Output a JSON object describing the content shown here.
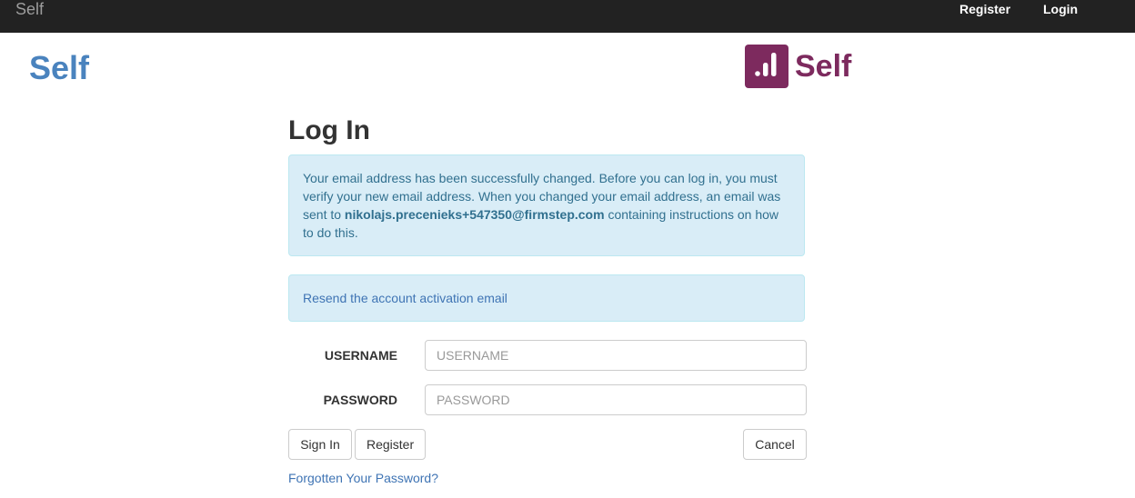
{
  "navbar": {
    "brand": "Self",
    "register": "Register",
    "login": "Login"
  },
  "header": {
    "site_title": "Self",
    "logo_text": "Self"
  },
  "page_title": "Log In",
  "alert": {
    "text_before": "Your email address has been successfully changed. Before you can log in, you must verify your new email address. When you changed your email address, an email was sent to ",
    "email": "nikolajs.precenieks+547350@firmstep.com",
    "text_after": " containing instructions on how to do this."
  },
  "resend_link": "Resend the account activation email",
  "form": {
    "username_label": "USERNAME",
    "username_placeholder": "USERNAME",
    "username_value": "",
    "password_label": "PASSWORD",
    "password_placeholder": "PASSWORD",
    "password_value": ""
  },
  "buttons": {
    "sign_in": "Sign In",
    "register": "Register",
    "cancel": "Cancel"
  },
  "forgot_link": "Forgotten Your Password?",
  "colors": {
    "navbar_bg": "#222222",
    "brand_blue": "#4a83be",
    "logo_purple": "#7d2a5e",
    "alert_bg": "#d9edf7",
    "alert_text": "#31708f",
    "link": "#3f74b4"
  }
}
